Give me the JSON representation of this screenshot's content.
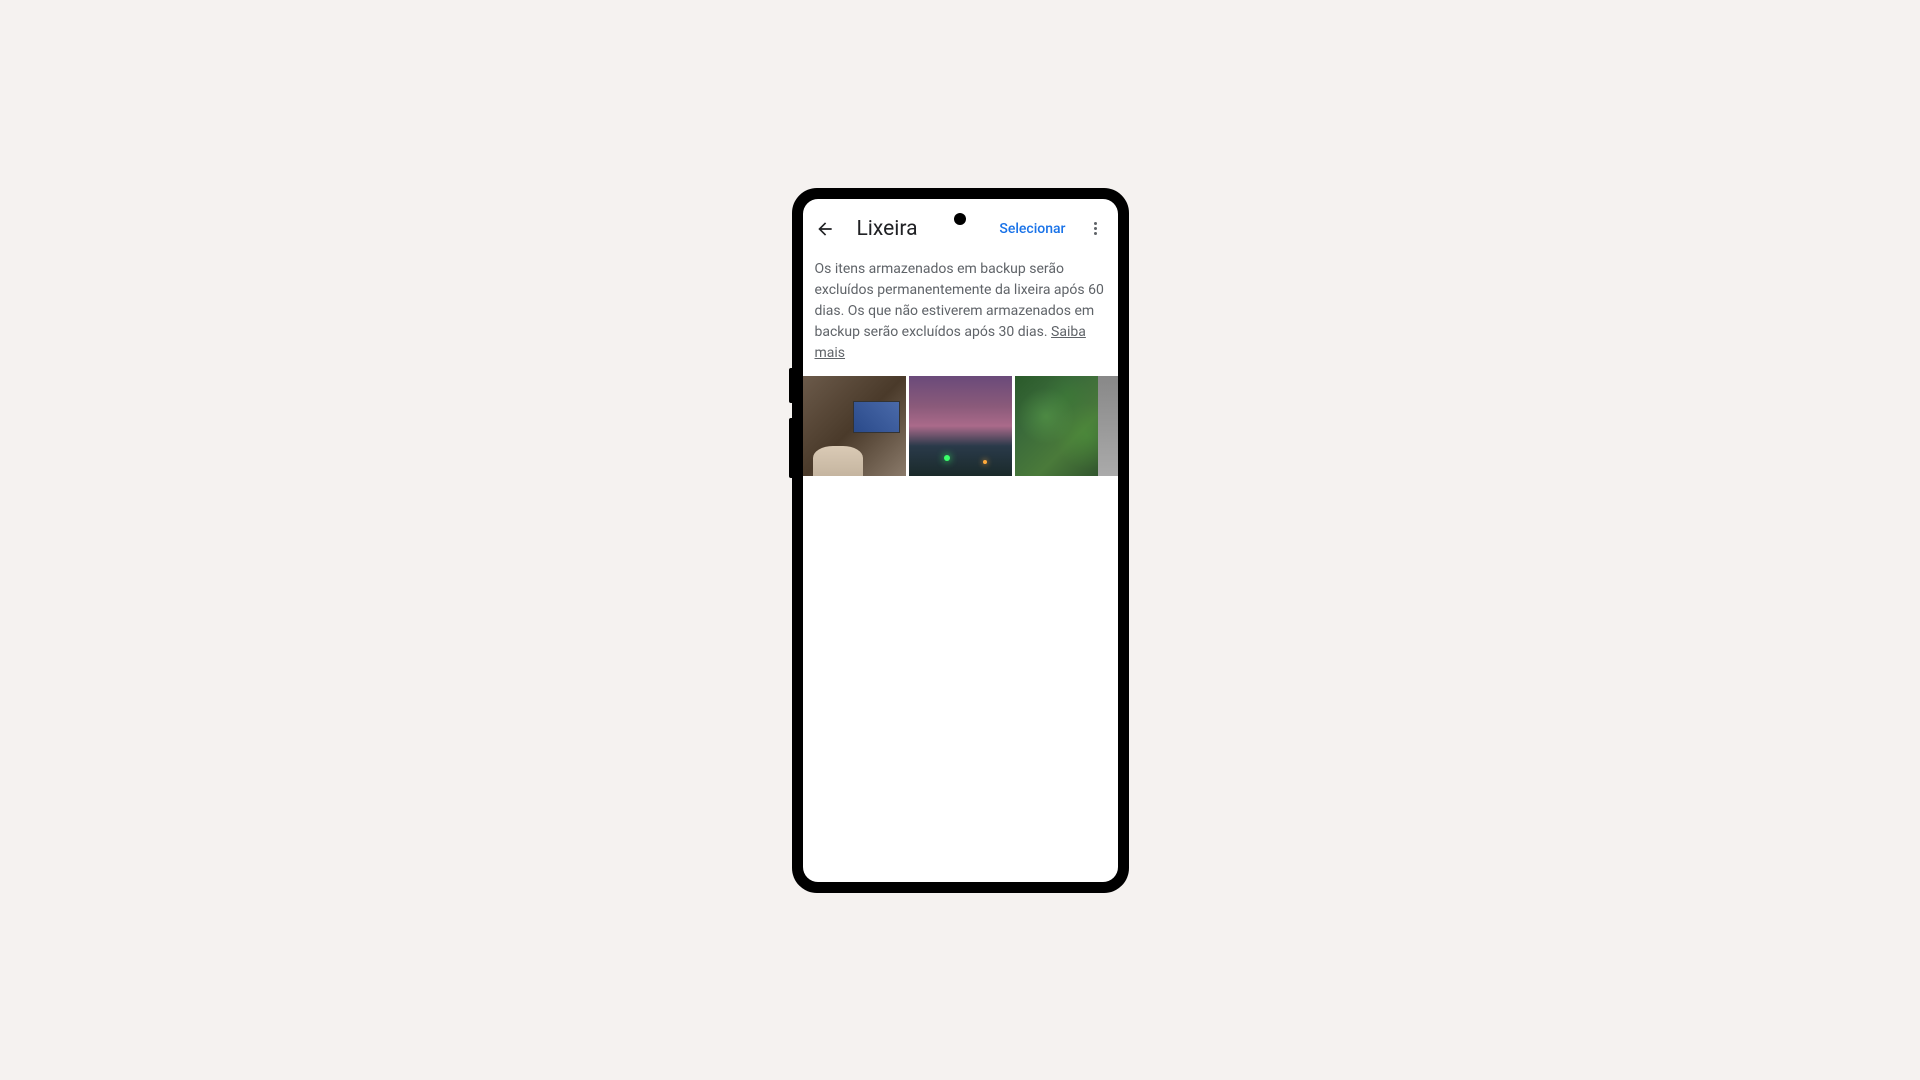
{
  "header": {
    "title": "Lixeira",
    "select_label": "Selecionar"
  },
  "info": {
    "text": "Os itens armazenados em backup serão excluídos permanentemente da lixeira após 60 dias. Os que não estiverem armazenados em backup serão excluídos após 30 dias. ",
    "link_label": "Saiba mais"
  },
  "thumbnails": [
    {
      "name": "tv-room-photo"
    },
    {
      "name": "sunset-photo"
    },
    {
      "name": "plants-photo"
    }
  ]
}
